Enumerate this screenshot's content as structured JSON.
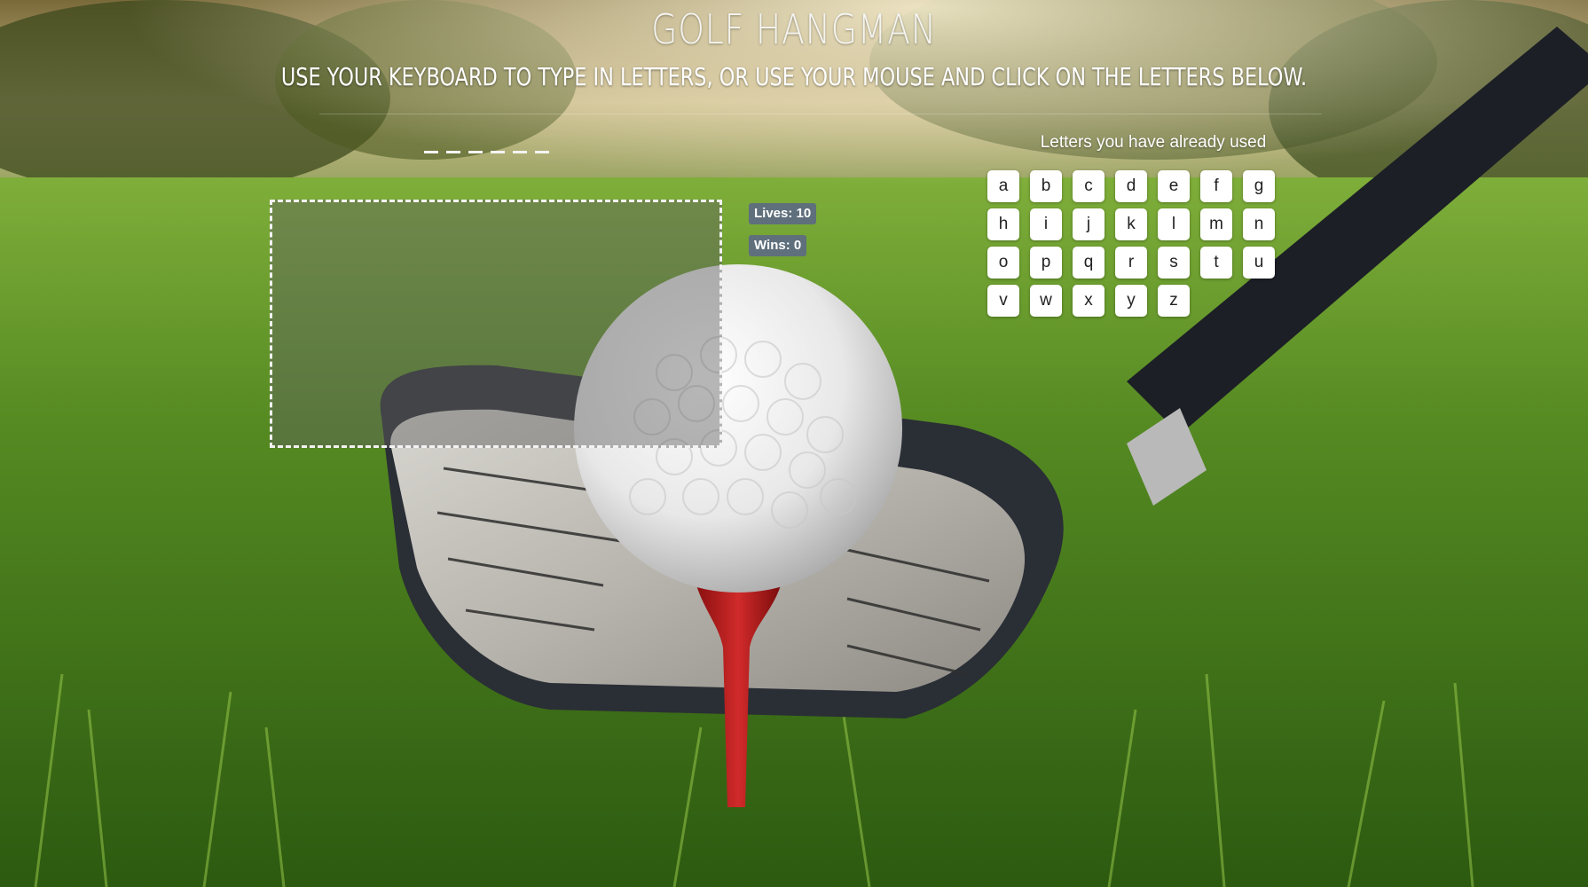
{
  "header": {
    "title": "GOLF HANGMAN",
    "subtitle": "USE YOUR KEYBOARD TO TYPE IN LETTERS, OR USE YOUR MOUSE AND CLICK ON THE LETTERS BELOW."
  },
  "word": {
    "slots": [
      "_",
      "_",
      "_",
      "_",
      "_",
      "_"
    ]
  },
  "stats": {
    "lives": "Lives: 10",
    "wins": "Wins: 0"
  },
  "letters_panel": {
    "title": "Letters you have already used",
    "letters": [
      "a",
      "b",
      "c",
      "d",
      "e",
      "f",
      "g",
      "h",
      "i",
      "j",
      "k",
      "l",
      "m",
      "n",
      "o",
      "p",
      "q",
      "r",
      "s",
      "t",
      "u",
      "v",
      "w",
      "x",
      "y",
      "z"
    ]
  },
  "background": {
    "description_icon": "golf-ball-on-tee-with-driver-background",
    "colors": {
      "grass": "#3f7a1c",
      "sky": "#cdbf8f",
      "ball": "#f2f2f2",
      "tee": "#b51d1d",
      "club": "#2a2e35"
    }
  }
}
